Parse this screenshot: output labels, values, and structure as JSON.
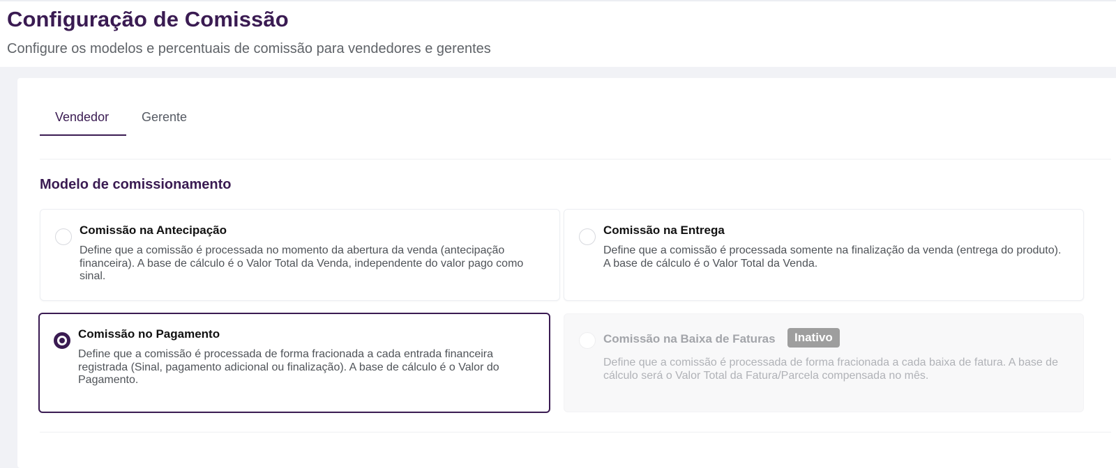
{
  "header": {
    "title": "Configuração de Comissão",
    "subtitle": "Configure os modelos e percentuais de comissão para vendedores e gerentes"
  },
  "tabs": [
    {
      "label": "Vendedor",
      "active": true
    },
    {
      "label": "Gerente",
      "active": false
    }
  ],
  "section": {
    "title": "Modelo de comissionamento"
  },
  "options": [
    {
      "title": "Comissão na Antecipação",
      "description": "Define que a comissão é processada no momento da abertura da venda (antecipação financeira). A base de cálculo é o Valor Total da Venda, independente do valor pago como sinal.",
      "selected": false,
      "enabled": true
    },
    {
      "title": "Comissão na Entrega",
      "description": "Define que a comissão é processada somente na finalização da venda (entrega do produto). A base de cálculo é o Valor Total da Venda.",
      "selected": false,
      "enabled": true
    },
    {
      "title": "Comissão no Pagamento",
      "description": "Define que a comissão é processada de forma fracionada a cada entrada financeira registrada (Sinal, pagamento adicional ou finalização). A base de cálculo é o Valor do Pagamento.",
      "selected": true,
      "enabled": true
    },
    {
      "title": "Comissão na Baixa de Faturas",
      "badge": "Inativo",
      "description": "Define que a comissão é processada de forma fracionada a cada baixa de fatura. A base de cálculo será o Valor Total da Fatura/Parcela compensada no mês.",
      "selected": false,
      "enabled": false
    }
  ],
  "colors": {
    "primary": "#3a1b52",
    "background": "#f1f2f6",
    "badge": "#9e9e9e"
  }
}
